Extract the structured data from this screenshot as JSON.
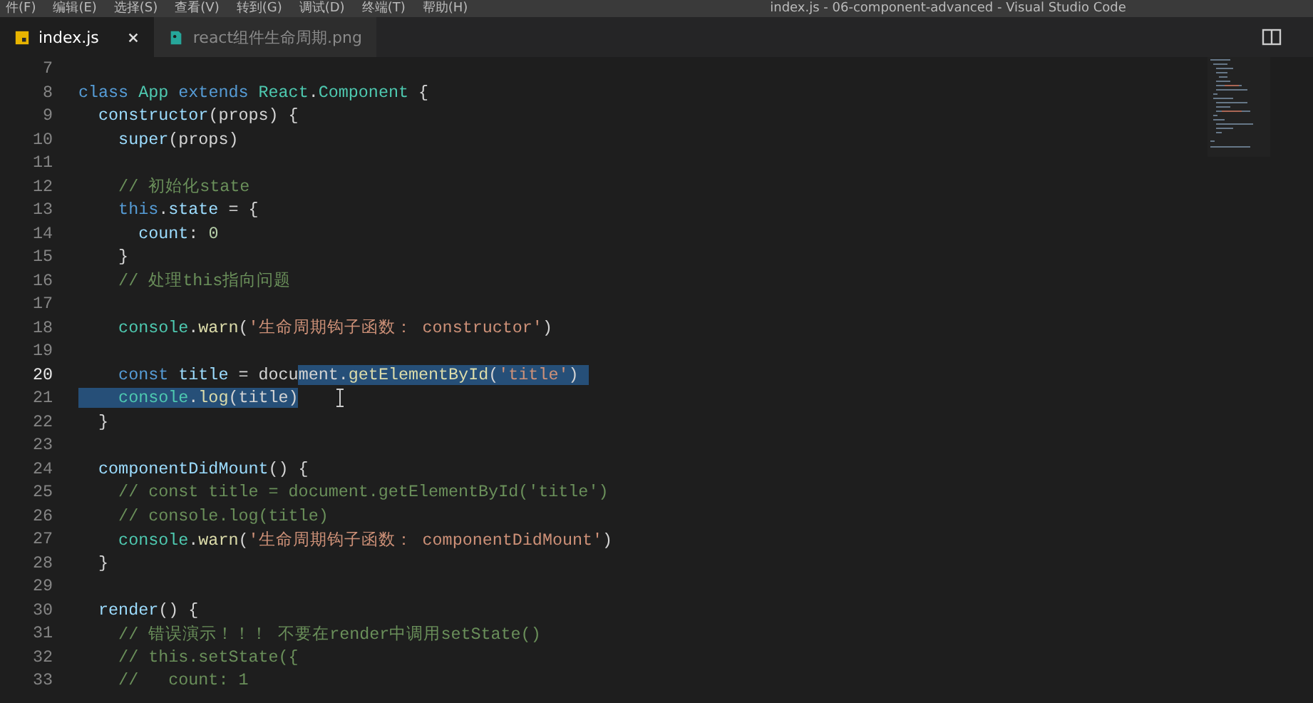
{
  "menu_bar": {
    "items": [
      "件(F)",
      "编辑(E)",
      "选择(S)",
      "查看(V)",
      "转到(G)",
      "调试(D)",
      "终端(T)",
      "帮助(H)"
    ],
    "title": "index.js - 06-component-advanced - Visual Studio Code"
  },
  "tabs": [
    {
      "label": "index.js",
      "kind": "js",
      "selected": true
    },
    {
      "label": "react组件生命周期.png",
      "kind": "image",
      "selected": false
    }
  ],
  "editor": {
    "lines": [
      {
        "number": "7",
        "active": false
      },
      {
        "number": "8",
        "active": false,
        "tokens": [
          {
            "text": "class ",
            "kind": "keyword"
          },
          {
            "text": "App ",
            "kind": "class"
          },
          {
            "text": "extends ",
            "kind": "keyword"
          },
          {
            "text": "React",
            "kind": "class"
          },
          {
            "text": ".",
            "kind": "plain"
          },
          {
            "text": "Component",
            "kind": "class"
          },
          {
            "text": " {",
            "kind": "plain"
          }
        ]
      },
      {
        "number": "9",
        "active": false,
        "tokens": [
          {
            "text": "  constructor",
            "kind": "member"
          },
          {
            "text": "(props) {",
            "kind": "plain"
          }
        ]
      },
      {
        "number": "10",
        "active": false,
        "tokens": [
          {
            "text": "    super",
            "kind": "member"
          },
          {
            "text": "(props)",
            "kind": "plain"
          }
        ]
      },
      {
        "number": "11",
        "active": false
      },
      {
        "number": "12",
        "active": false,
        "tokens": [
          {
            "text": "    // 初始化state",
            "kind": "comment"
          }
        ]
      },
      {
        "number": "13",
        "active": false,
        "tokens": [
          {
            "text": "    this",
            "kind": "keyword"
          },
          {
            "text": ".",
            "kind": "plain"
          },
          {
            "text": "state",
            "kind": "member"
          },
          {
            "text": " = {",
            "kind": "plain"
          }
        ]
      },
      {
        "number": "14",
        "active": false,
        "tokens": [
          {
            "text": "      count",
            "kind": "member"
          },
          {
            "text": ": ",
            "kind": "plain"
          },
          {
            "text": "0",
            "kind": "number"
          }
        ]
      },
      {
        "number": "15",
        "active": false,
        "tokens": [
          {
            "text": "    }",
            "kind": "plain"
          }
        ]
      },
      {
        "number": "16",
        "active": false,
        "tokens": [
          {
            "text": "    // 处理this指向问题",
            "kind": "comment"
          }
        ]
      },
      {
        "number": "17",
        "active": false
      },
      {
        "number": "18",
        "active": false,
        "tokens": [
          {
            "text": "    console",
            "kind": "class"
          },
          {
            "text": ".",
            "kind": "plain"
          },
          {
            "text": "warn",
            "kind": "function"
          },
          {
            "text": "(",
            "kind": "plain"
          },
          {
            "text": "'生命周期钩子函数： constructor'",
            "kind": "string"
          },
          {
            "text": ")",
            "kind": "plain"
          }
        ]
      },
      {
        "number": "19",
        "active": false
      },
      {
        "number": "20",
        "active": true,
        "tokens": [
          {
            "text": "    const ",
            "kind": "keyword"
          },
          {
            "text": "title ",
            "kind": "member"
          },
          {
            "text": "= docu",
            "kind": "plain"
          },
          {
            "text": "ment",
            "kind": "plain",
            "selected": true
          },
          {
            "text": ".",
            "kind": "plain",
            "selected": true
          },
          {
            "text": "getElementById",
            "kind": "function",
            "selected": true
          },
          {
            "text": "(",
            "kind": "plain",
            "selected": true
          },
          {
            "text": "'title'",
            "kind": "string",
            "selected": true
          },
          {
            "text": ") ",
            "kind": "plain",
            "selected": true
          }
        ]
      },
      {
        "number": "21",
        "active": false,
        "tokens": [
          {
            "text": "    console",
            "kind": "class",
            "selected": true
          },
          {
            "text": ".",
            "kind": "plain",
            "selected": true
          },
          {
            "text": "log",
            "kind": "function",
            "selected": true
          },
          {
            "text": "(title)",
            "kind": "plain",
            "selected": true
          }
        ]
      },
      {
        "number": "22",
        "active": false,
        "tokens": [
          {
            "text": "  }",
            "kind": "plain"
          }
        ]
      },
      {
        "number": "23",
        "active": false
      },
      {
        "number": "24",
        "active": false,
        "tokens": [
          {
            "text": "  componentDidMount",
            "kind": "member"
          },
          {
            "text": "() {",
            "kind": "plain"
          }
        ]
      },
      {
        "number": "25",
        "active": false,
        "tokens": [
          {
            "text": "    // const title = document.getElementById('title')",
            "kind": "comment"
          }
        ]
      },
      {
        "number": "26",
        "active": false,
        "tokens": [
          {
            "text": "    // console.log(title)",
            "kind": "comment"
          }
        ]
      },
      {
        "number": "27",
        "active": false,
        "tokens": [
          {
            "text": "    console",
            "kind": "class"
          },
          {
            "text": ".",
            "kind": "plain"
          },
          {
            "text": "warn",
            "kind": "function"
          },
          {
            "text": "(",
            "kind": "plain"
          },
          {
            "text": "'生命周期钩子函数： componentDidMount'",
            "kind": "string"
          },
          {
            "text": ")",
            "kind": "plain"
          }
        ]
      },
      {
        "number": "28",
        "active": false,
        "tokens": [
          {
            "text": "  }",
            "kind": "plain"
          }
        ]
      },
      {
        "number": "29",
        "active": false
      },
      {
        "number": "30",
        "active": false,
        "tokens": [
          {
            "text": "  render",
            "kind": "member"
          },
          {
            "text": "() {",
            "kind": "plain"
          }
        ]
      },
      {
        "number": "31",
        "active": false,
        "tokens": [
          {
            "text": "    // 错误演示！！！ 不要在render中调用setState()",
            "kind": "comment"
          }
        ]
      },
      {
        "number": "32",
        "active": false,
        "tokens": [
          {
            "text": "    // this.setState({",
            "kind": "comment"
          }
        ]
      },
      {
        "number": "33",
        "active": false,
        "tokens": [
          {
            "text": "    //   count: 1",
            "kind": "comment"
          }
        ]
      }
    ]
  }
}
